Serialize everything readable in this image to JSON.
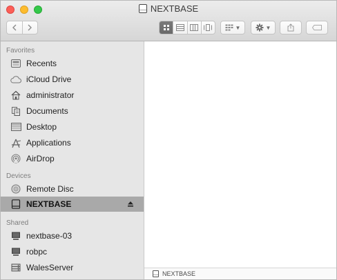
{
  "window": {
    "title": "NEXTBASE"
  },
  "toolbar": {
    "back_icon": "chevron-left-icon",
    "forward_icon": "chevron-right-icon",
    "views": [
      "icon-view",
      "list-view",
      "column-view",
      "cover-flow-view"
    ],
    "active_view": "icon-view",
    "arrange_icon": "arrange-grid-icon",
    "action_icon": "gear-icon",
    "share_icon": "share-icon",
    "tag_icon": "tag-icon"
  },
  "sidebar": {
    "favorites_header": "Favorites",
    "favorites": [
      {
        "label": "Recents",
        "icon": "recents-icon"
      },
      {
        "label": "iCloud Drive",
        "icon": "cloud-icon"
      },
      {
        "label": "administrator",
        "icon": "home-icon"
      },
      {
        "label": "Documents",
        "icon": "documents-icon"
      },
      {
        "label": "Desktop",
        "icon": "desktop-icon"
      },
      {
        "label": "Applications",
        "icon": "applications-icon"
      },
      {
        "label": "AirDrop",
        "icon": "airdrop-icon"
      }
    ],
    "devices_header": "Devices",
    "devices": [
      {
        "label": "Remote Disc",
        "icon": "disc-icon"
      },
      {
        "label": "NEXTBASE",
        "icon": "external-drive-icon",
        "selected": true
      }
    ],
    "shared_header": "Shared",
    "shared": [
      {
        "label": "nextbase-03",
        "icon": "computer-icon"
      },
      {
        "label": "robpc",
        "icon": "computer-icon"
      },
      {
        "label": "WalesServer",
        "icon": "server-icon"
      }
    ]
  },
  "pathbar": {
    "label": "NEXTBASE"
  },
  "colors": {
    "selection": "#a9a9a9",
    "sidebar_bg": "#e6e6e6",
    "close": "#fc5f57",
    "minimize": "#fdbc2e",
    "zoom": "#34c84a"
  }
}
